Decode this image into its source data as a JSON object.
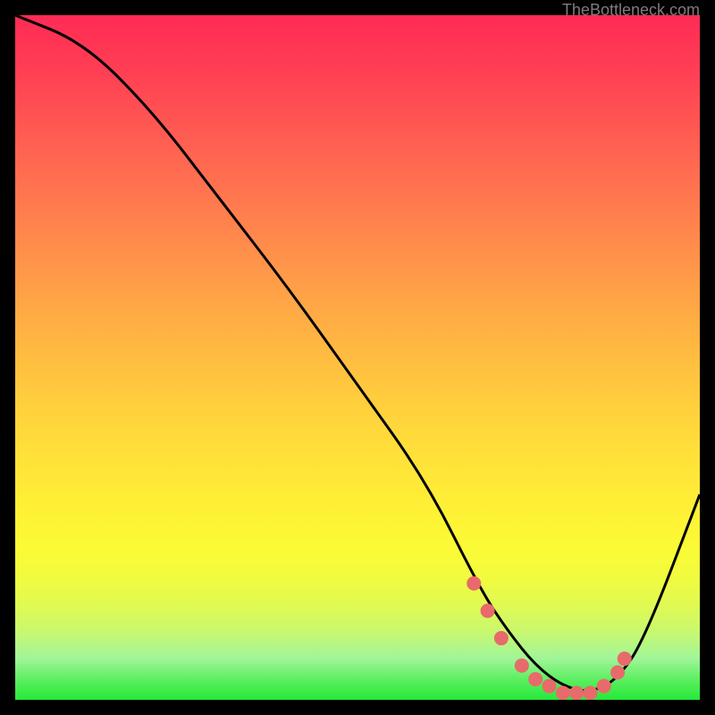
{
  "watermark": "TheBottleneck.com",
  "chart_data": {
    "type": "line",
    "title": "",
    "xlabel": "",
    "ylabel": "",
    "xlim": [
      0,
      100
    ],
    "ylim": [
      0,
      100
    ],
    "series": [
      {
        "name": "bottleneck-curve",
        "x": [
          0,
          10,
          20,
          30,
          40,
          50,
          60,
          68,
          72,
          76,
          80,
          84,
          88,
          92,
          100
        ],
        "values": [
          100,
          96,
          86,
          73,
          60,
          46,
          32,
          16,
          10,
          5,
          2,
          1,
          3,
          9,
          30
        ]
      }
    ],
    "markers": {
      "name": "highlight-dots",
      "color": "#e86a6a",
      "x": [
        67,
        69,
        71,
        74,
        76,
        78,
        80,
        82,
        84,
        86,
        88,
        89
      ],
      "values": [
        17,
        13,
        9,
        5,
        3,
        2,
        1,
        1,
        1,
        2,
        4,
        6
      ]
    },
    "gradient_meaning": "vertical gradient from red (high bottleneck) at top to green (low bottleneck) at bottom"
  }
}
